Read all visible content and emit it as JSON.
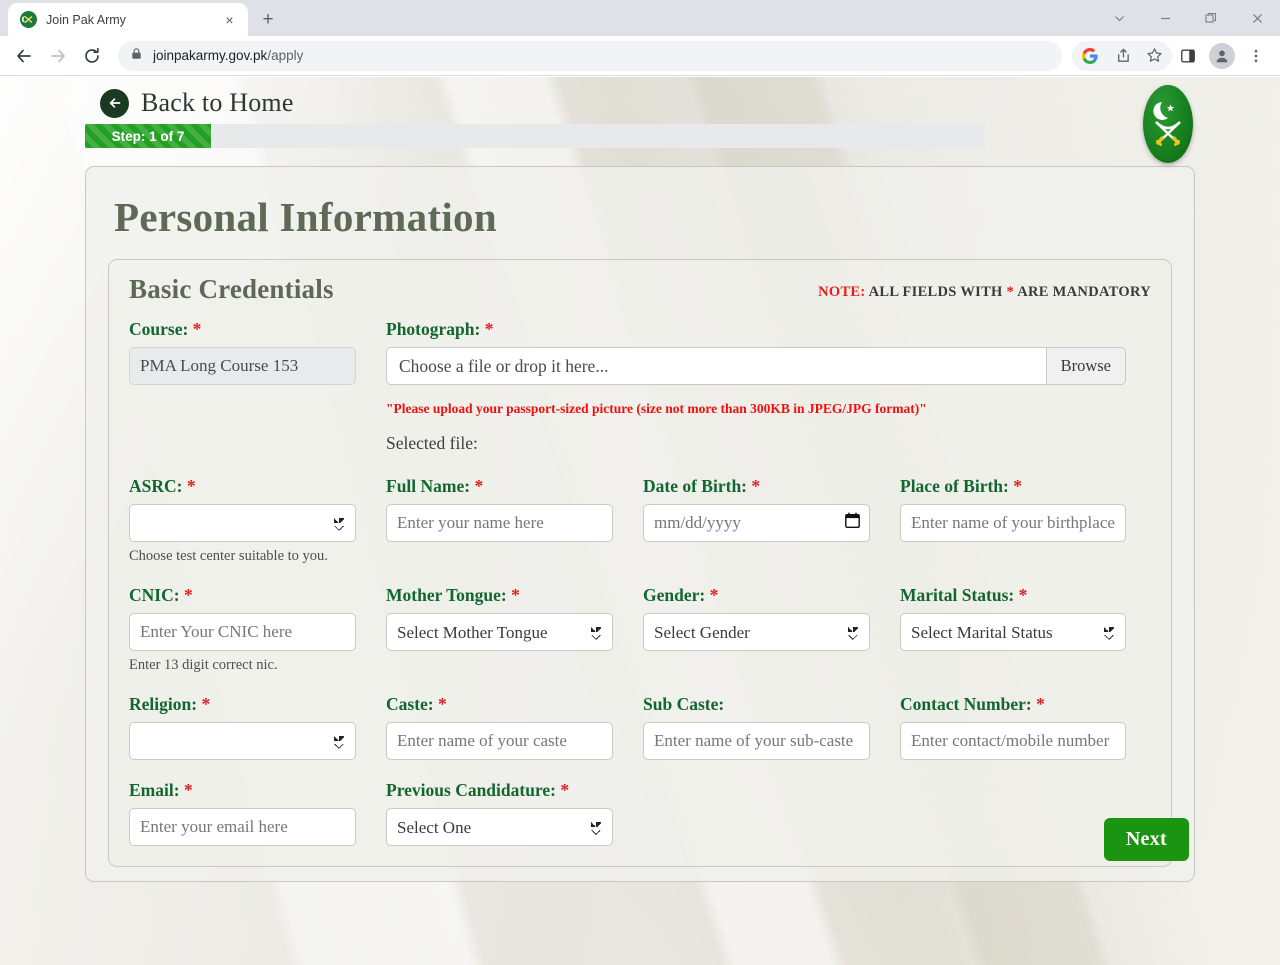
{
  "browser": {
    "tab_title": "Join Pak Army",
    "tab_favicon": "army-crest-icon",
    "new_tab_label": "+",
    "close_tab_label": "×",
    "url_host": "joinpakarmy.gov.pk",
    "url_path": "/apply",
    "back_icon": "back-arrow-icon",
    "forward_icon": "forward-arrow-icon",
    "reload_icon": "reload-icon",
    "lock_icon": "lock-icon",
    "google_icon": "google-icon",
    "share_icon": "share-icon",
    "bookmark_icon": "star-icon",
    "sidepanel_icon": "side-panel-icon",
    "profile_icon": "profile-avatar-icon",
    "menu_icon": "three-dot-menu-icon",
    "tab_search_icon": "chevron-down-icon",
    "minimize_icon": "minimize-icon",
    "maximize_icon": "maximize-icon",
    "window_close_icon": "close-icon"
  },
  "header": {
    "back_label": "Back to Home",
    "back_icon": "circle-left-arrow-icon",
    "step_label": "Step: 1 of 7",
    "progress_percent": 14,
    "logo_icon": "pak-army-crest-logo"
  },
  "form": {
    "page_title": "Personal Information",
    "section_title": "Basic Credentials",
    "note_keyword": "NOTE:",
    "note_text": " ALL FIELDS WITH ",
    "note_asterisk": "*",
    "note_tail": " ARE MANDATORY",
    "next_label": "Next"
  },
  "fields": {
    "course": {
      "label": "Course:",
      "required": "*",
      "value": "PMA Long Course 153"
    },
    "photograph": {
      "label": "Photograph:",
      "required": "*",
      "file_placeholder": "Choose a file or drop it here...",
      "browse_label": "Browse",
      "warning": "\"Please upload your passport-sized picture (size not more than 300KB in JPEG/JPG format)\"",
      "selected_file_label": "Selected file:"
    },
    "asrc": {
      "label": "ASRC:",
      "required": "*",
      "value": "",
      "helper": "Choose test center suitable to you."
    },
    "full_name": {
      "label": "Full Name:",
      "required": "*",
      "placeholder": "Enter your name here"
    },
    "date_of_birth": {
      "label": "Date of Birth:",
      "required": "*",
      "placeholder": "mm/dd/yyyy",
      "icon": "calendar-icon"
    },
    "place_of_birth": {
      "label": "Place of Birth:",
      "required": "*",
      "placeholder": "Enter name of your birthplace"
    },
    "cnic": {
      "label": "CNIC:",
      "required": "*",
      "placeholder": "Enter Your CNIC here",
      "helper": "Enter 13 digit correct nic."
    },
    "mother_tongue": {
      "label": "Mother Tongue:",
      "required": "*",
      "value": "Select Mother Tongue"
    },
    "gender": {
      "label": "Gender:",
      "required": "*",
      "value": "Select Gender"
    },
    "marital_status": {
      "label": "Marital Status:",
      "required": "*",
      "value": "Select Marital Status"
    },
    "religion": {
      "label": "Religion:",
      "required": "*",
      "value": ""
    },
    "caste": {
      "label": "Caste:",
      "required": "*",
      "placeholder": "Enter name of your caste"
    },
    "sub_caste": {
      "label": "Sub Caste:",
      "required": "",
      "placeholder": "Enter name of your sub-caste"
    },
    "contact_number": {
      "label": "Contact Number:",
      "required": "*",
      "placeholder": "Enter contact/mobile number"
    },
    "email": {
      "label": "Email:",
      "required": "*",
      "placeholder": "Enter your email here"
    },
    "previous_candidature": {
      "label": "Previous Candidature:",
      "required": "*",
      "value": "Select One"
    }
  },
  "colors": {
    "brand_green": "#12662f",
    "progress_green": "#21a022",
    "next_green": "#1b9412",
    "required_red": "#e02020",
    "heading_olive": "#5f6a56"
  }
}
